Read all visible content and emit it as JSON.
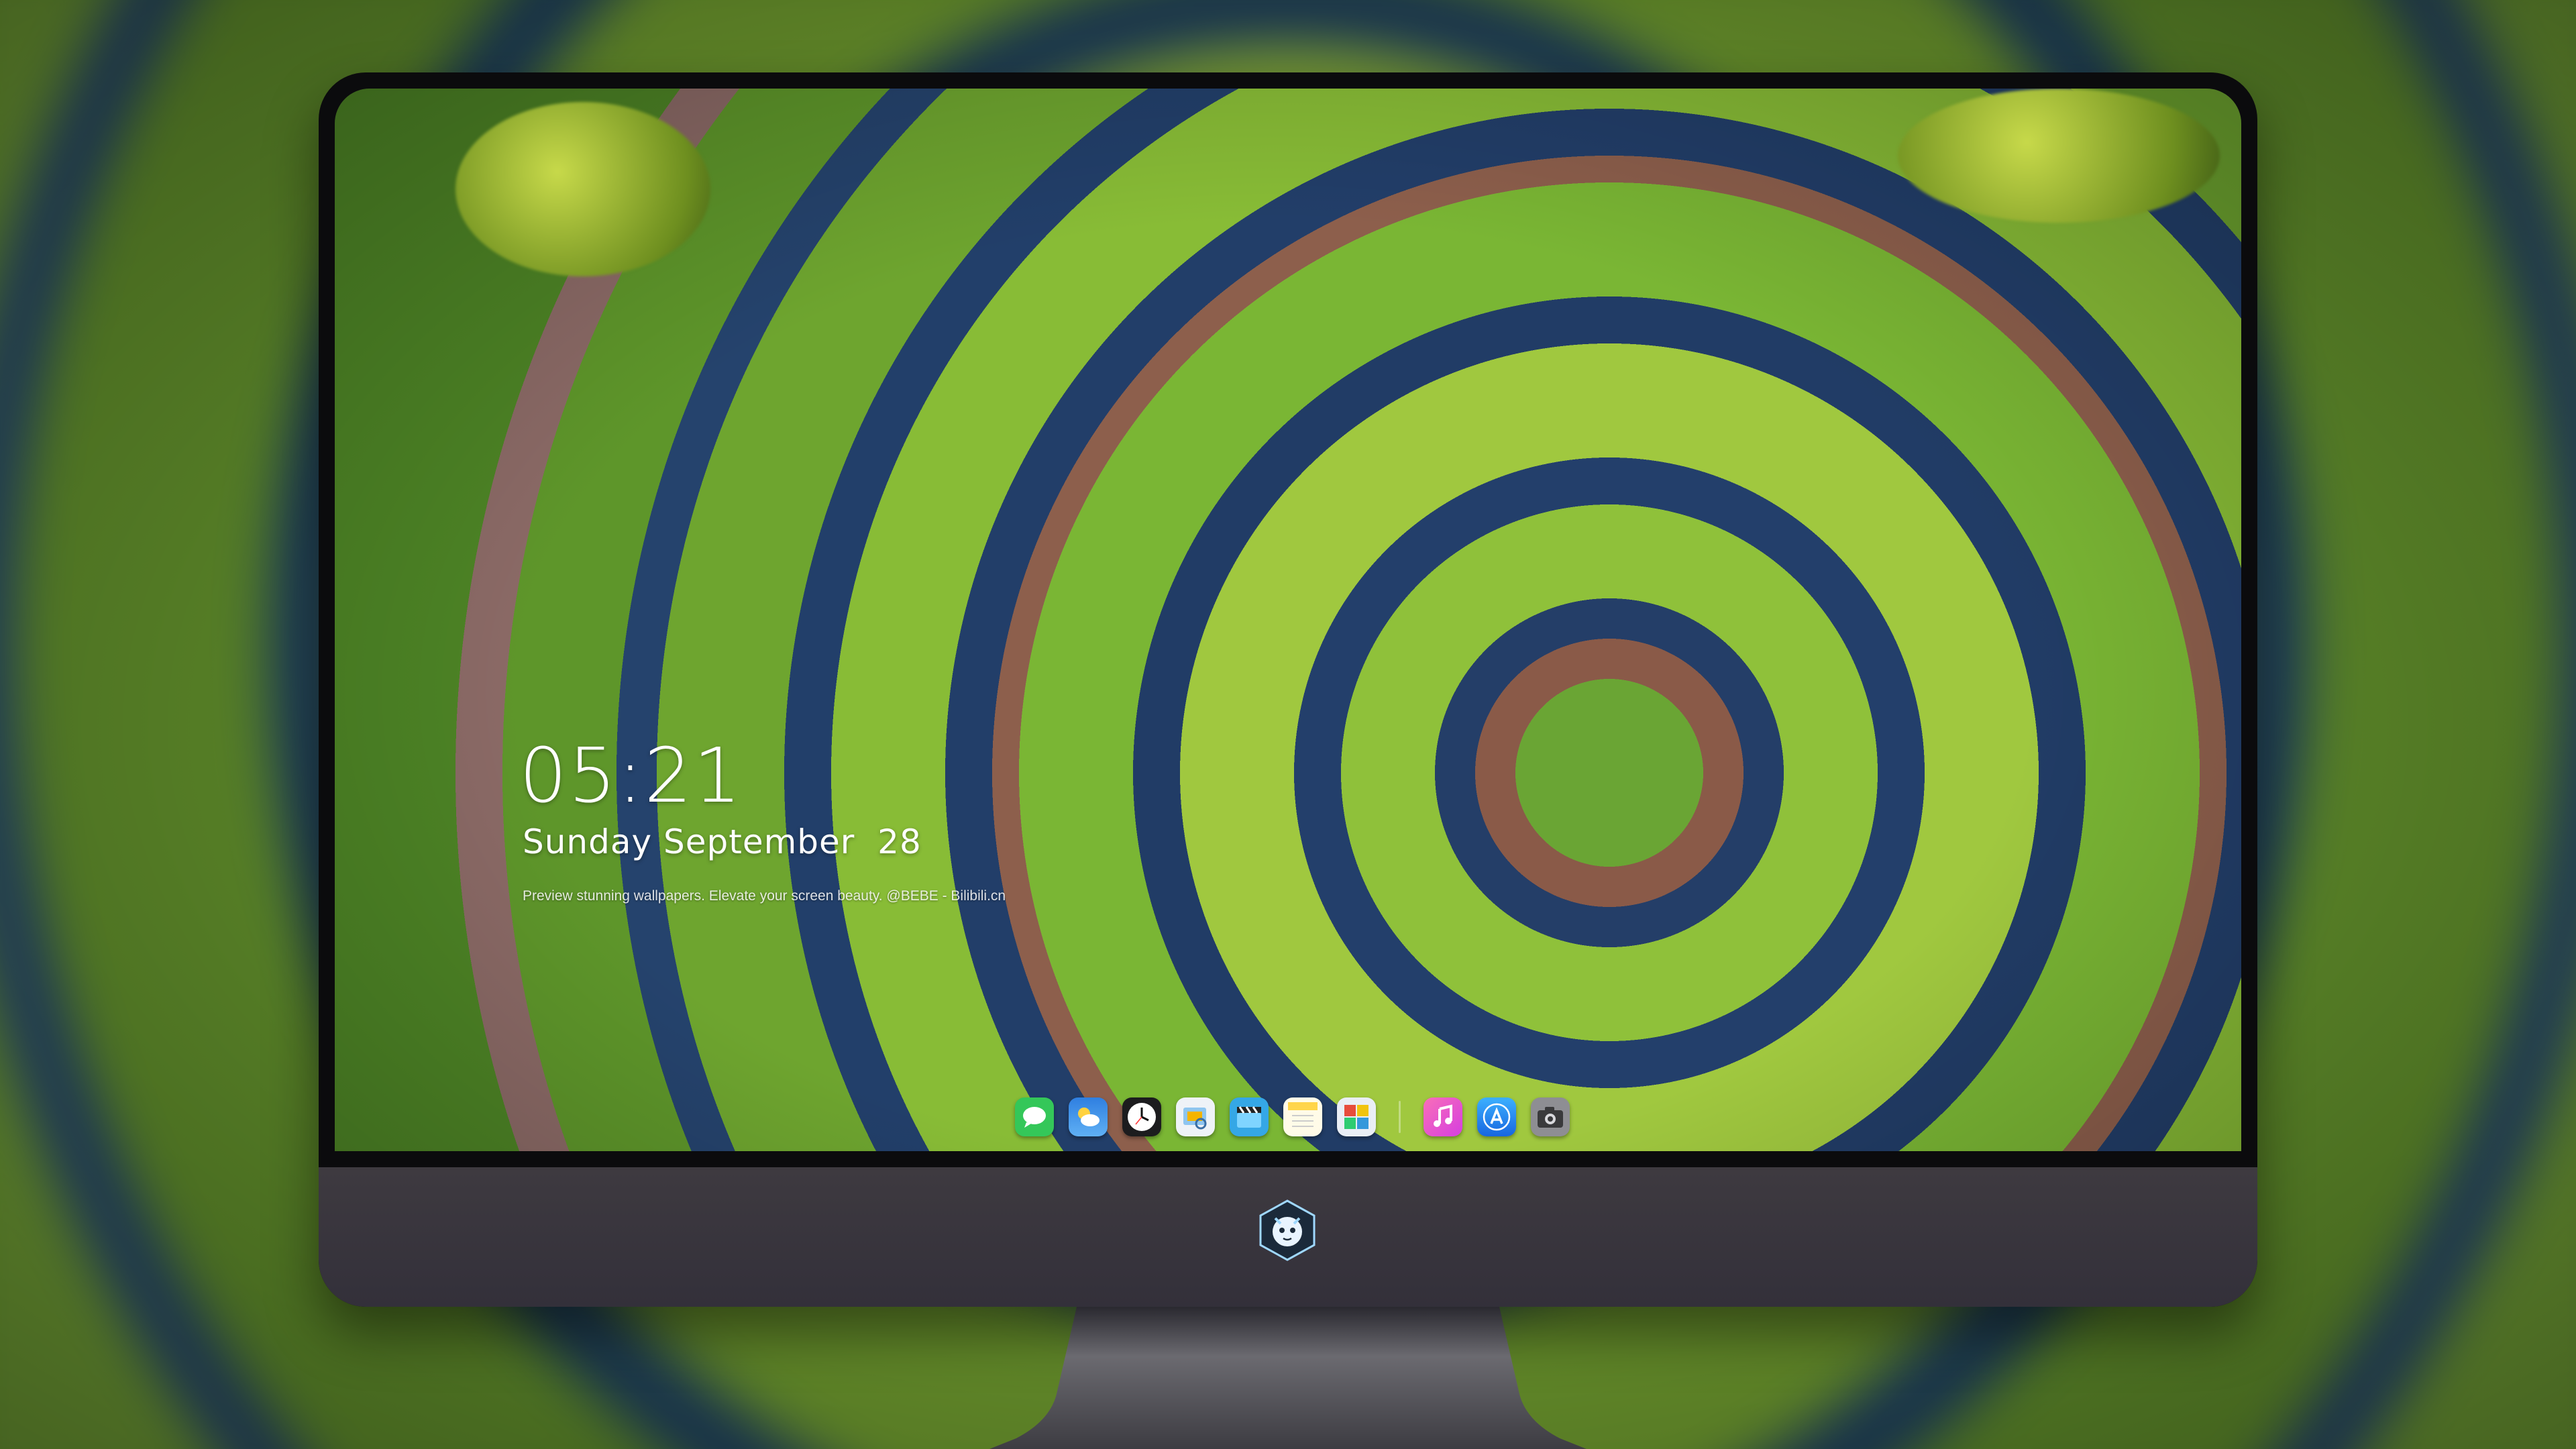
{
  "lock_screen": {
    "time": "05:21",
    "date": "Sunday September  28",
    "tagline": "Preview stunning wallpapers. Elevate your screen beauty. @BEBE - Bilibili.cn"
  },
  "dock": {
    "items": [
      {
        "name": "messages-icon",
        "glyph": "💬",
        "color": "#34c759"
      },
      {
        "name": "weather-icon",
        "glyph": "⛅",
        "color": "#3a8ef0"
      },
      {
        "name": "clock-icon",
        "glyph": "🕓",
        "color": "#1c1c1e"
      },
      {
        "name": "preview-icon",
        "glyph": "🖼",
        "color": "#f2f2f7"
      },
      {
        "name": "clips-icon",
        "glyph": "🎬",
        "color": "#35a7e6"
      },
      {
        "name": "notes-icon",
        "glyph": "📝",
        "color": "#ffd54a"
      },
      {
        "name": "photo-booth-icon",
        "glyph": "🧩",
        "color": "#e9eef5"
      },
      {
        "name": "music-icon",
        "glyph": "♫",
        "color": "#f24fa8"
      },
      {
        "name": "app-store-icon",
        "glyph": "Ⓐ",
        "color": "#1e88f5"
      },
      {
        "name": "camera-icon",
        "glyph": "📷",
        "color": "#9a9a9e"
      }
    ]
  },
  "colors": {
    "bezel": "#0b0b0d",
    "chin": "#3e3a40",
    "stand": "#6b6a70"
  }
}
